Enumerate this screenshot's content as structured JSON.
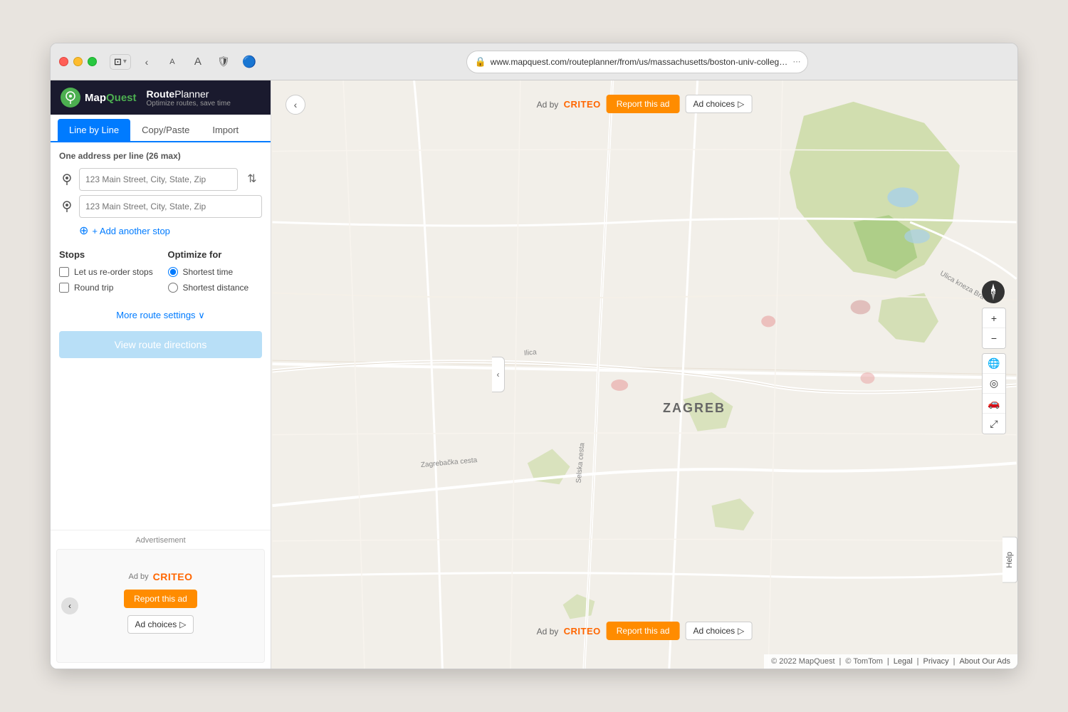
{
  "browser": {
    "url": "www.mapquest.com/routeplanner/from/us/massachusetts/boston-univ-college-a...",
    "traffic_lights": [
      "red",
      "yellow",
      "green"
    ]
  },
  "header": {
    "logo": {
      "icon": "MQ",
      "brand": "MapQuest",
      "subtitle": "RoutePlanner",
      "tagline": "Optimize routes, save time"
    }
  },
  "tabs": [
    {
      "label": "Line by Line",
      "active": true
    },
    {
      "label": "Copy/Paste",
      "active": false
    },
    {
      "label": "Import",
      "active": false
    }
  ],
  "form": {
    "address_hint": "One address per line",
    "address_max": "(26 max)",
    "placeholder": "123 Main Street, City, State, Zip",
    "add_stop_label": "+ Add another stop",
    "stops_title": "Stops",
    "optimize_title": "Optimize for",
    "stops_options": [
      {
        "label": "Let us re-order stops",
        "checked": false
      },
      {
        "label": "Round trip",
        "checked": false
      }
    ],
    "optimize_options": [
      {
        "label": "Shortest time",
        "selected": true
      },
      {
        "label": "Shortest distance",
        "selected": false
      }
    ],
    "more_settings": "More route settings",
    "view_directions_label": "View route directions"
  },
  "advertisement_sidebar": {
    "label": "Advertisement",
    "ad_by": "Ad by",
    "criteo": "CRITEO",
    "report_btn": "Report this ad",
    "choices_btn": "Ad choices",
    "choices_icon": "▷"
  },
  "map": {
    "city_label": "ZAGREB",
    "road_labels": [
      "Ilica",
      "Selska cesta",
      "Zagrebačka cesta",
      "Ulica kneza Bra"
    ],
    "ad_top": {
      "ad_by": "Ad by",
      "criteo": "CRITEO",
      "report_btn": "Report this ad",
      "choices_btn": "Ad choices",
      "choices_icon": "▷"
    },
    "ad_bottom": {
      "ad_by": "Ad by",
      "criteo": "CRITEO",
      "report_btn": "Report this ad",
      "choices_btn": "Ad choices",
      "choices_icon": "▷"
    },
    "controls": {
      "compass": "N",
      "zoom_in": "+",
      "zoom_out": "−",
      "icons": [
        "🌐",
        "◎",
        "🚗",
        "⤢"
      ]
    },
    "help_label": "Help",
    "collapse_icon": "‹"
  },
  "footer": {
    "copyright": "© 2022 MapQuest",
    "sep1": "|",
    "tomtom": "© TomTom",
    "sep2": "|",
    "legal": "Legal",
    "sep3": "|",
    "privacy": "Privacy",
    "sep4": "|",
    "about_ads": "About Our Ads"
  }
}
